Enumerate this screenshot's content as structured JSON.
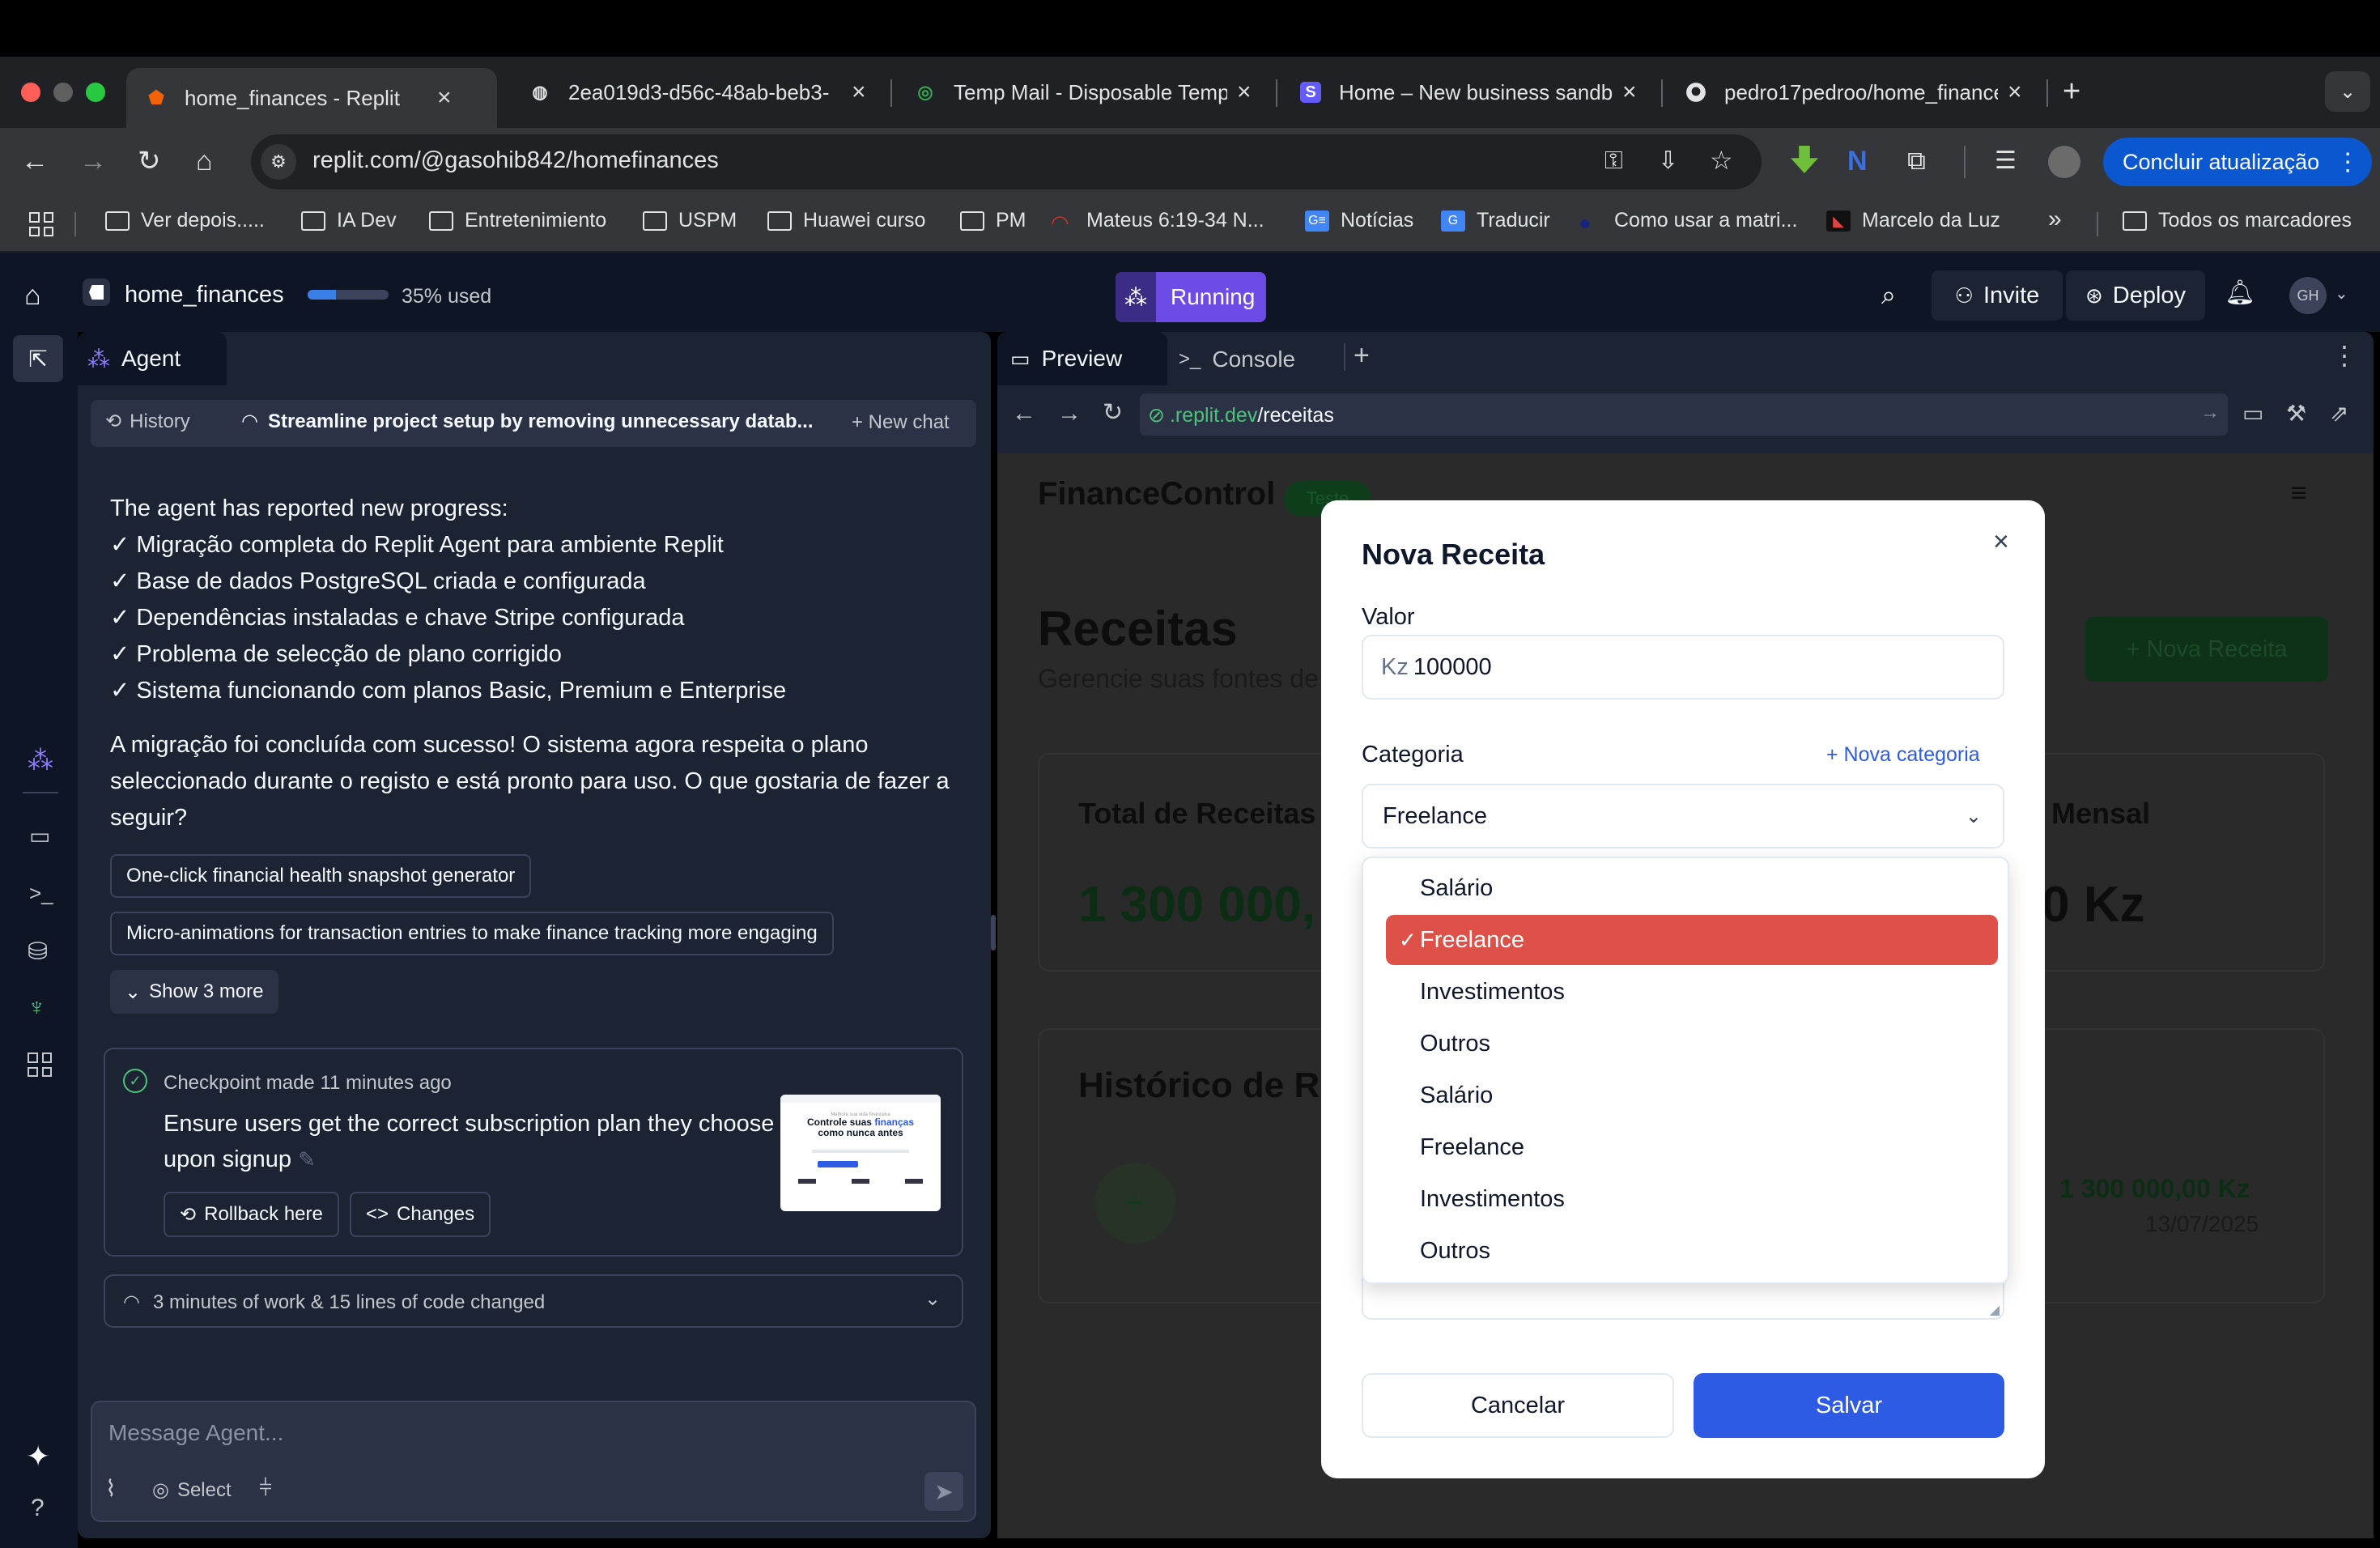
{
  "browser": {
    "tabs": [
      {
        "title": "home_finances - Replit",
        "active": true
      },
      {
        "title": "2ea019d3-d56c-48ab-beb3-",
        "active": false
      },
      {
        "title": "Temp Mail - Disposable Temp",
        "active": false
      },
      {
        "title": "Home – New business sandb",
        "active": false
      },
      {
        "title": "pedro17pedroo/home_finance",
        "active": false
      }
    ],
    "new_tab": "+",
    "url": "replit.com/@gasohib842/homefinances",
    "update_button": "Concluir atualização",
    "bookmarks": [
      "Ver depois.....",
      "IA Dev",
      "Entretenimiento",
      "USPM",
      "Huawei curso",
      "PM",
      "Mateus 6:19-34 N...",
      "Notícias",
      "Traducir",
      "Como usar a matri...",
      "Marcelo da Luz"
    ],
    "bookmarks_overflow": "»",
    "all_bookmarks": "Todos os marcadores"
  },
  "replit": {
    "project": "home_finances",
    "usage_label": "35% used",
    "usage_fraction": 0.35,
    "running": "Running",
    "invite": "Invite",
    "deploy": "Deploy",
    "avatar": "GH",
    "agent_tab": "Agent",
    "history": "History",
    "thread_title": "Streamline project setup by removing unnecessary datab...",
    "new_chat": "+ New chat",
    "message_lines": [
      "The agent has reported new progress:",
      "✓ Migração completa do Replit Agent para ambiente Replit",
      "✓ Base de dados PostgreSQL criada e configurada",
      "✓ Dependências instaladas e chave Stripe configurada",
      "✓ Problema de selecção de plano corrigido",
      "✓ Sistema funcionando com planos Basic, Premium e Enterprise"
    ],
    "message_para_lines": [
      "A migração foi concluída com sucesso! O sistema agora respeita o plano",
      "seleccionado durante o registo e está pronto para uso. O que gostaria de fazer a",
      "seguir?"
    ],
    "suggestions": [
      "One-click financial health snapshot generator",
      "Micro-animations for transaction entries to make finance tracking more engaging"
    ],
    "show_more": "Show 3 more",
    "checkpoint_label": "Checkpoint made",
    "checkpoint_time": "11 minutes ago",
    "checkpoint_desc_lines": [
      "Ensure users get the correct subscription plan they choose",
      "upon signup"
    ],
    "rollback": "Rollback here",
    "changes": "Changes",
    "thumb_small": "Melhore sua vida financeira",
    "thumb_title_1": "Controle suas",
    "thumb_title_accent": "finanças",
    "thumb_title_2": "como nunca antes",
    "work_summary": "3 minutes of work & 15 lines of code changed",
    "message_placeholder": "Message Agent...",
    "select": "Select",
    "preview_tab": "Preview",
    "console_tab": "Console",
    "preview_url_prefix": ".replit.dev",
    "preview_url_path": "/receitas"
  },
  "app": {
    "brand": "FinanceControl",
    "badge": "Teste",
    "page_title": "Receitas",
    "page_subtitle": "Gerencie suas fontes de",
    "new_button": "+ Nova Receita",
    "total_label": "Total de Receitas",
    "total_value": "1 300 000,",
    "monthly_label": "Mensal",
    "monthly_value": "0 Kz",
    "history_title": "Histórico de Re",
    "entry_value": "1 300 000,00 Kz",
    "entry_date": "13/07/2025"
  },
  "modal": {
    "title": "Nova Receita",
    "valor_label": "Valor",
    "currency": "Kz",
    "valor_value": "100000",
    "categoria_label": "Categoria",
    "new_category": "+ Nova categoria",
    "selected": "Freelance",
    "options": [
      "Salário",
      "Freelance",
      "Investimentos",
      "Outros",
      "Salário",
      "Freelance",
      "Investimentos",
      "Outros"
    ],
    "selected_index": 1,
    "cancel": "Cancelar",
    "save": "Salvar"
  },
  "colors": {
    "accent": "#de5149",
    "save": "#2d5be3",
    "running": "#6d4ce6",
    "chrome_bg": "#35363a",
    "replit_bg": "#0e1525"
  }
}
